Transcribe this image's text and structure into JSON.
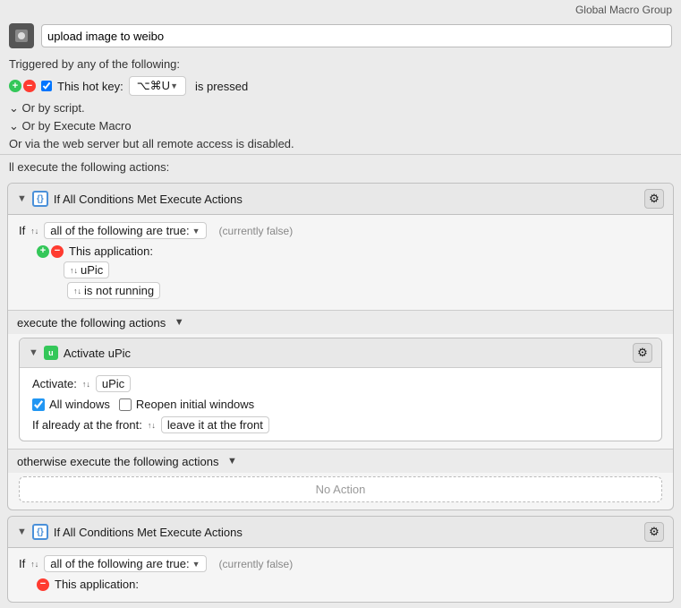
{
  "topBar": {
    "label": "Global Macro Group"
  },
  "macroTitle": "upload image to weibo",
  "triggeredLabel": "Triggered by any of the following:",
  "hotkey": {
    "addRemove": true,
    "checkboxChecked": true,
    "label": "This hot key:",
    "keyDisplay": "⌥⌘U",
    "pressedLabel": "is pressed"
  },
  "orScript": "Or by script.",
  "orExecuteMacro": "Or by Execute Macro",
  "webServerNote": "Or via the web server but all remote access is disabled.",
  "willExecuteLabel": "ll execute the following actions:",
  "conditionBlock1": {
    "title": "If All Conditions Met Execute Actions",
    "ifLabel": "If",
    "allOfLabel": "all of the following are true:",
    "currentlyFalse": "(currently false)",
    "thisApplicationLabel": "This application:",
    "appName": "uPic",
    "statusLabel": "is not running",
    "executeLabel": "execute the following actions",
    "activateBlock": {
      "title": "Activate uPic",
      "activateLabel": "Activate:",
      "activateApp": "uPic",
      "allWindows": true,
      "allWindowsLabel": "All windows",
      "reopenInitial": false,
      "reopenInitialLabel": "Reopen initial windows",
      "alreadyFrontLabel": "If already at the front:",
      "leaveLabel": "leave it at the front"
    },
    "otherwiseLabel": "otherwise execute the following actions",
    "noActionLabel": "No Action"
  },
  "conditionBlock2": {
    "title": "If All Conditions Met Execute Actions",
    "ifLabel": "If",
    "allOfLabel": "all of the following are true:",
    "currentlyFalse": "(currently false)",
    "thisApplicationLabel": "This application:"
  }
}
